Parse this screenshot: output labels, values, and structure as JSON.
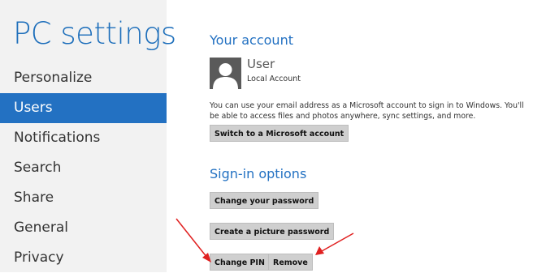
{
  "sidebar": {
    "title": "PC settings",
    "items": [
      {
        "label": "Personalize"
      },
      {
        "label": "Users"
      },
      {
        "label": "Notifications"
      },
      {
        "label": "Search"
      },
      {
        "label": "Share"
      },
      {
        "label": "General"
      },
      {
        "label": "Privacy"
      }
    ],
    "active_index": 1
  },
  "account": {
    "title": "Your account",
    "user_name": "User",
    "user_type": "Local Account",
    "description": "You can use your email address as a Microsoft account to sign in to Windows. You'll be able to access files and photos anywhere, sync settings, and more.",
    "switch_button": "Switch to a Microsoft account"
  },
  "signin": {
    "title": "Sign-in options",
    "change_password_button": "Change your password",
    "picture_password_button": "Create a picture password",
    "change_pin_button": "Change PIN",
    "remove_button": "Remove"
  },
  "colors": {
    "accent": "#2371c2",
    "sidebar_bg": "#f2f2f2",
    "annotation_arrow": "#e02020"
  }
}
